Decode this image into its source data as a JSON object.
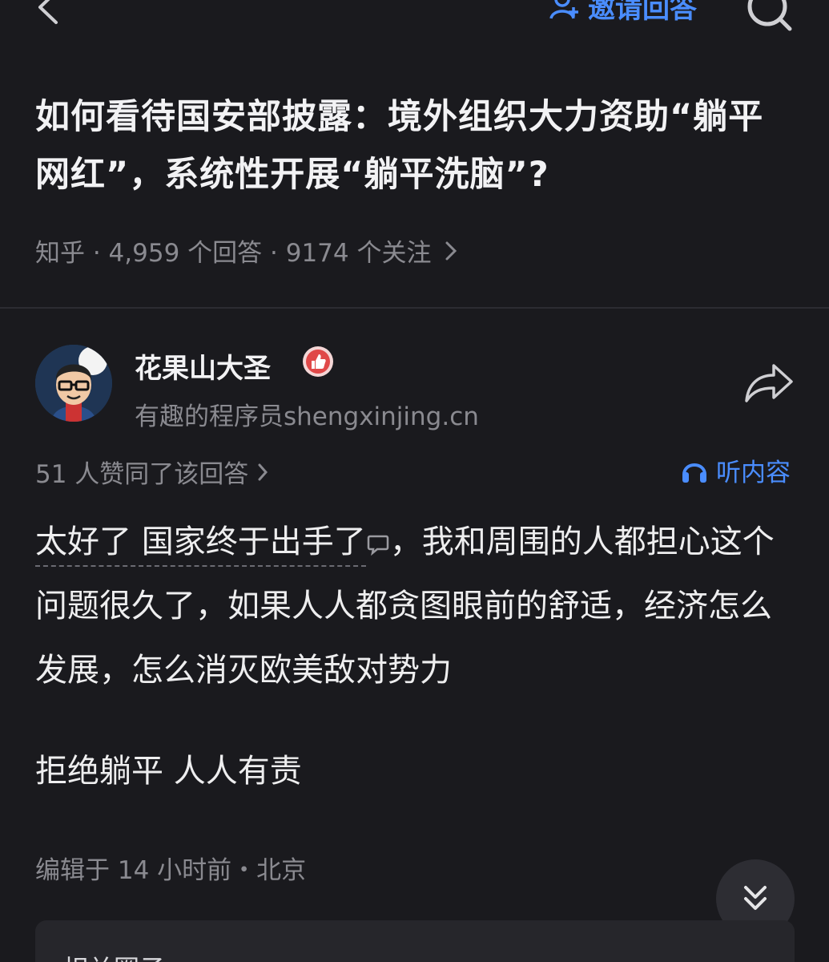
{
  "topbar": {
    "invite_label": "邀请回答"
  },
  "question": {
    "title": "如何看待国安部披露：境外组织大力资助“躺平网红”，系统性开展“躺平洗脑”?",
    "meta": "知乎 · 4,959 个回答 · 9174 个关注"
  },
  "author": {
    "name": "花果山大圣",
    "bio": "有趣的程序员shengxinjing.cn"
  },
  "answer": {
    "votes": "51 人赞同了该回答",
    "listen_label": "听内容",
    "highlighted_text": "太好了 国家终于出手了",
    "text_rest": "，我和周围的人都担心这个问题很久了，如果人人都贪图眼前的舒适，经济怎么发展，怎么消灭欧美敌对势力",
    "paragraph2": "拒绝躺平 人人有责",
    "edited": "编辑于 14 小时前・北京"
  },
  "related": {
    "title": "相关圈子"
  },
  "colors": {
    "background": "#1a1a1e",
    "accent": "#4a8dff",
    "muted_text": "#8a8a90"
  },
  "icons": [
    "back-icon",
    "invite-user-icon",
    "search-icon",
    "avatar",
    "badge-icon",
    "share-icon",
    "chevron-right-icon",
    "headphones-icon",
    "comment-icon",
    "double-chevron-down-icon"
  ]
}
